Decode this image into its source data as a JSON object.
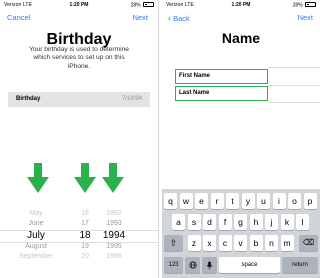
{
  "left": {
    "status": {
      "carrier": "Verizon  LTE",
      "time": "1:20 PM",
      "battery": "28%"
    },
    "nav": {
      "left": "Cancel",
      "right": "Next"
    },
    "title": "Birthday",
    "description": "Your birthday is used to determine which services to set up on this iPhone.",
    "birthday_row": {
      "label": "Birthday",
      "value": "7/18/94"
    },
    "picker": {
      "months": [
        "May",
        "June",
        "July",
        "August",
        "September"
      ],
      "days": [
        "16",
        "17",
        "18",
        "19",
        "20"
      ],
      "years": [
        "1992",
        "1993",
        "1994",
        "1995",
        "1996"
      ]
    },
    "arrow_color": "#2ab14b"
  },
  "right": {
    "status": {
      "carrier": "Verizon  LTE",
      "time": "1:20 PM",
      "battery": "28%"
    },
    "nav": {
      "back": "Back",
      "right": "Next"
    },
    "title": "Name",
    "fields": {
      "first_name": "First Name",
      "last_name": "Last Name"
    },
    "highlight_color": "#2ab14b",
    "keyboard": {
      "row1": [
        "q",
        "w",
        "e",
        "r",
        "t",
        "y",
        "u",
        "i",
        "o",
        "p"
      ],
      "row2": [
        "a",
        "s",
        "d",
        "f",
        "g",
        "h",
        "j",
        "k",
        "l"
      ],
      "row3": [
        "z",
        "x",
        "c",
        "v",
        "b",
        "n",
        "m"
      ],
      "numbers_key": "123",
      "space_key": "space",
      "return_key": "return"
    }
  }
}
